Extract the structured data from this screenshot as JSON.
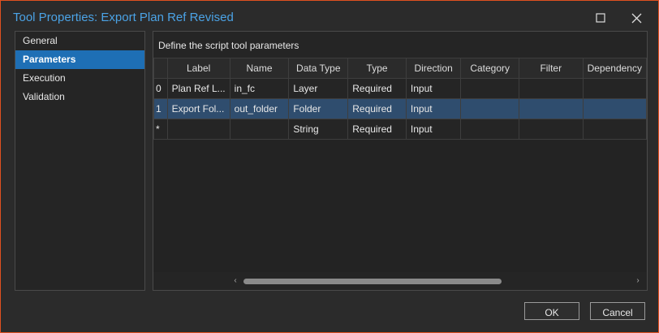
{
  "window": {
    "title": "Tool Properties: Export Plan Ref Revised",
    "maximize_icon": "maximize-icon",
    "close_icon": "close-icon"
  },
  "sidebar": {
    "items": [
      {
        "label": "General",
        "active": false
      },
      {
        "label": "Parameters",
        "active": true
      },
      {
        "label": "Execution",
        "active": false
      },
      {
        "label": "Validation",
        "active": false
      }
    ]
  },
  "main": {
    "title": "Define the script tool parameters",
    "columns": [
      "",
      "Label",
      "Name",
      "Data Type",
      "Type",
      "Direction",
      "Category",
      "Filter",
      "Dependency"
    ],
    "rows": [
      {
        "index": "0",
        "label": "Plan Ref L...",
        "name": "in_fc",
        "data_type": "Layer",
        "type": "Required",
        "direction": "Input",
        "category": "",
        "filter": "",
        "dependency": ""
      },
      {
        "index": "1",
        "label": "Export Fol...",
        "name": "out_folder",
        "data_type": "Folder",
        "type": "Required",
        "direction": "Input",
        "category": "",
        "filter": "",
        "dependency": ""
      },
      {
        "index": "*",
        "label": "",
        "name": "",
        "data_type": "String",
        "type": "Required",
        "direction": "Input",
        "category": "",
        "filter": "",
        "dependency": ""
      }
    ],
    "selected_row": 1
  },
  "buttons": {
    "ok": "OK",
    "cancel": "Cancel"
  },
  "colors": {
    "title_blue": "#4ba3e6",
    "active_item": "#1e6fb5",
    "selected_row": "#2f4d6e",
    "window_border": "#e05020"
  }
}
